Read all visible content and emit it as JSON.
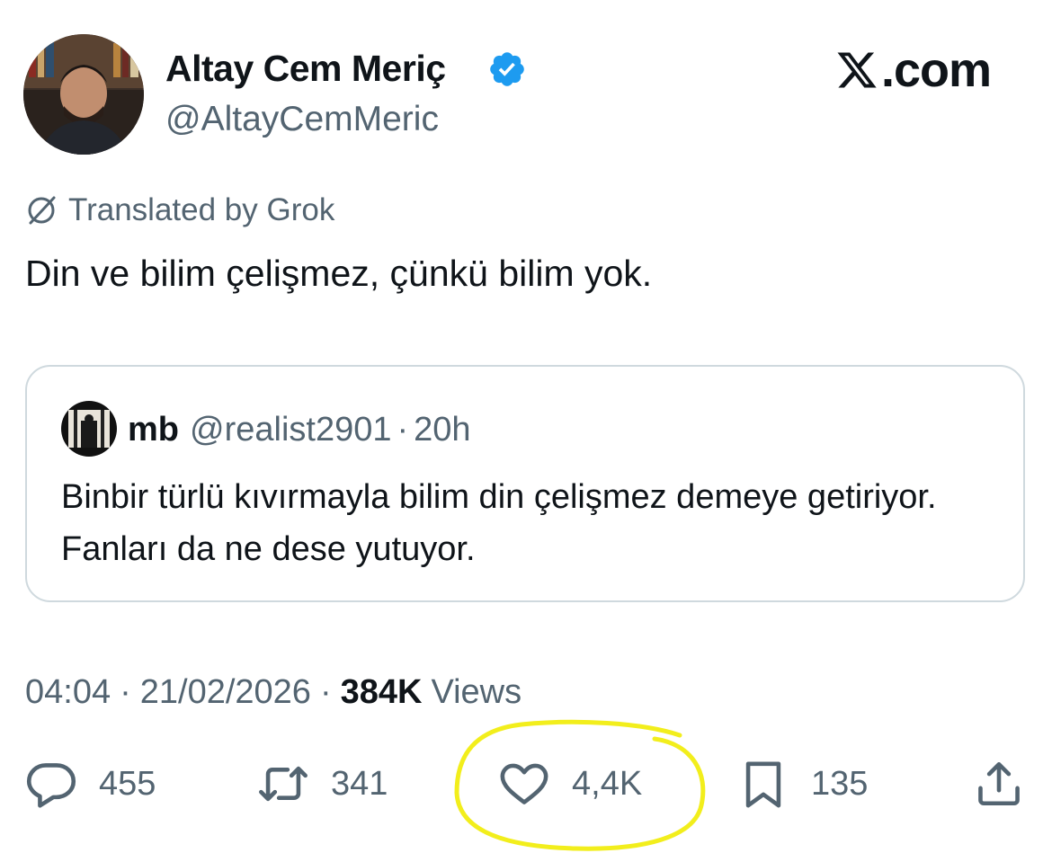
{
  "author": {
    "display_name": "Altay Cem Meriç",
    "handle": "@AltayCemMeric",
    "verified_icon": "verified-badge-icon"
  },
  "brand": {
    "text": ".com",
    "icon": "x-logo-icon"
  },
  "translation": {
    "label": "Translated by Grok",
    "icon": "translate-icon"
  },
  "tweet": {
    "text": "Din ve bilim çelişmez, çünkü bilim yok."
  },
  "quote": {
    "name": "mb",
    "handle": "@realist2901",
    "separator": "·",
    "time": "20h",
    "text": "Binbir türlü kıvırmayla bilim din çelişmez demeye getiriyor. Fanları da ne dese yutuyor."
  },
  "meta": {
    "time": "04:04",
    "separator": "·",
    "date": "21/02/2026",
    "views_count": "384K",
    "views_label": "Views"
  },
  "actions": {
    "replies": "455",
    "reposts": "341",
    "likes": "4,4K",
    "bookmarks": "135"
  },
  "colors": {
    "text": "#0f1419",
    "secondary": "#536471",
    "verified": "#1d9bf0",
    "highlight": "#f2ee1c",
    "border": "#cfd9de"
  }
}
